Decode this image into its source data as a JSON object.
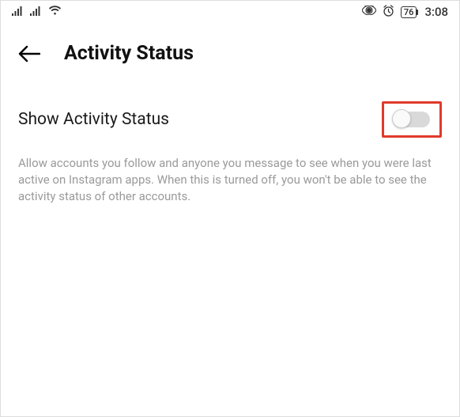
{
  "status": {
    "battery": "76",
    "time": "3:08"
  },
  "header": {
    "title": "Activity Status"
  },
  "setting": {
    "label": "Show Activity Status",
    "description": "Allow accounts you follow and anyone you message to see when you were last active on Instagram apps. When this is turned off, you won't be able to see the activity status of other accounts."
  }
}
